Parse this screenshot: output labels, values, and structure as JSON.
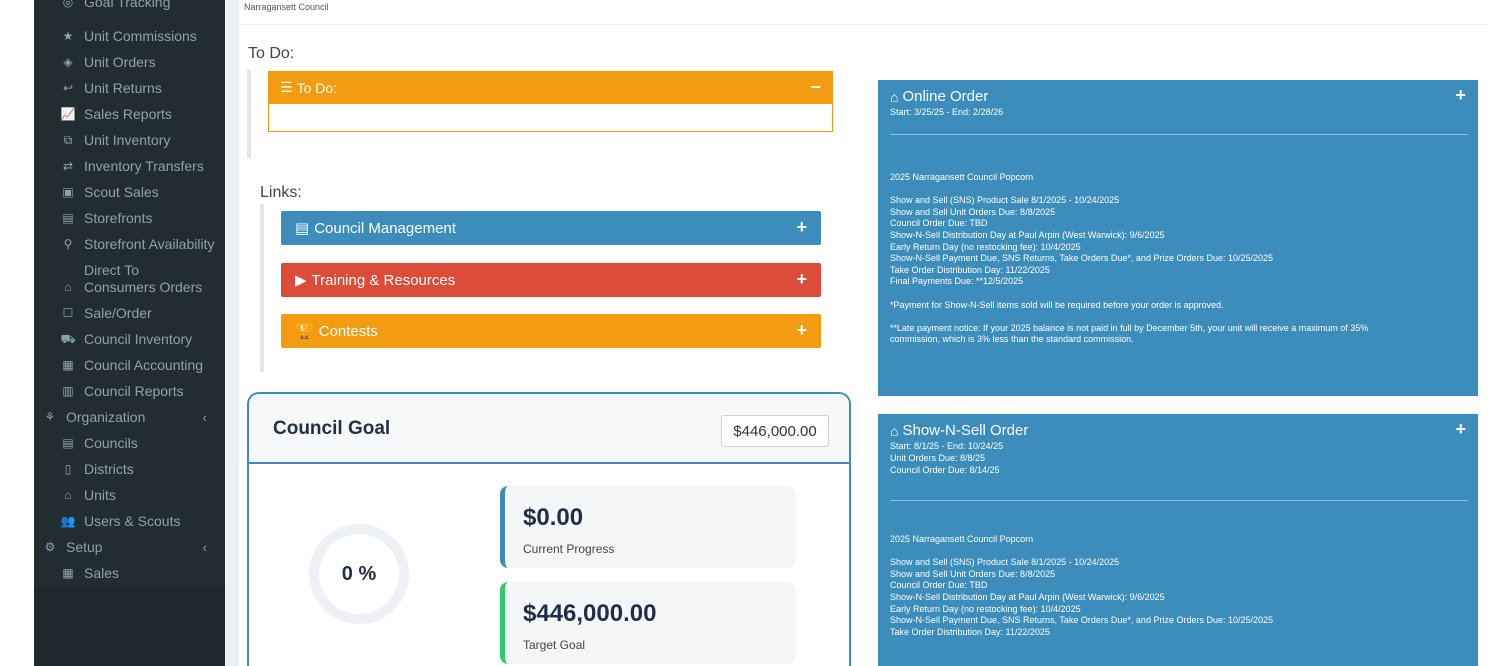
{
  "sidebar": {
    "items": [
      {
        "label": "Goal Tracking",
        "icon": "goal-icon"
      },
      {
        "label": "Unit Commissions",
        "icon": "star-icon"
      },
      {
        "label": "Unit Orders",
        "icon": "tag-icon"
      },
      {
        "label": "Unit Returns",
        "icon": "reply-icon"
      },
      {
        "label": "Sales Reports",
        "icon": "line-chart-icon"
      },
      {
        "label": "Unit Inventory",
        "icon": "cubes-icon"
      },
      {
        "label": "Inventory Transfers",
        "icon": "exchange-icon"
      },
      {
        "label": "Scout Sales",
        "icon": "box-icon"
      },
      {
        "label": "Storefronts",
        "icon": "building-icon"
      },
      {
        "label": "Storefront Availability",
        "icon": "map-marker-icon"
      },
      {
        "label_line1": "Direct To",
        "label_line2": "Consumers Orders",
        "icon": "basket-icon"
      },
      {
        "label": "Sale/Order",
        "icon": "square-icon"
      },
      {
        "label": "Council Inventory",
        "icon": "truck-icon"
      },
      {
        "label": "Council Accounting",
        "icon": "calculator-icon"
      },
      {
        "label": "Council Reports",
        "icon": "bar-chart-icon"
      }
    ],
    "organization": {
      "label": "Organization",
      "icon": "sitemap-icon",
      "chevron": "‹"
    },
    "org_items": [
      {
        "label": "Councils",
        "icon": "building-icon"
      },
      {
        "label": "Districts",
        "icon": "building-outline-icon"
      },
      {
        "label": "Units",
        "icon": "home-icon"
      },
      {
        "label": "Users & Scouts",
        "icon": "users-icon"
      }
    ],
    "setup": {
      "label": "Setup",
      "icon": "cogs-icon",
      "chevron": "‹"
    },
    "setup_items": [
      {
        "label": "Sales",
        "icon": "calendar-icon"
      }
    ]
  },
  "breadcrumb": "Narragansett Council",
  "todo": {
    "section_label": "To Do:",
    "box_title": "To Do:",
    "collapse_symbol": "−"
  },
  "links": {
    "section_label": "Links:",
    "items": [
      {
        "label": "Council Management",
        "icon": "building-icon",
        "symbol": "+"
      },
      {
        "label": "Training & Resources",
        "icon": "youtube-icon",
        "symbol": "+"
      },
      {
        "label": "Contests",
        "icon": "trophy-icon",
        "symbol": "+"
      }
    ]
  },
  "goal": {
    "title": "Council Goal",
    "input_value": "$446,000.00",
    "percent": "0 %",
    "progress_fraction": 0,
    "current_amount": "$0.00",
    "current_label": "Current Progress",
    "target_amount": "$446,000.00",
    "target_label": "Target Goal"
  },
  "online_order": {
    "title": "Online Order",
    "dates": "Start: 3/25/25 - End: 2/28/26",
    "lines": [
      "2025 Narragansett Council Popcorn",
      "",
      "Show and Sell (SNS) Product Sale 8/1/2025 - 10/24/2025",
      "Show and Sell Unit Orders Due: 8/8/2025",
      "Council Order Due: TBD",
      "Show-N-Sell Distribution Day at Paul Arpin (West Warwick): 9/6/2025",
      "Early Return Day (no restocking fee): 10/4/2025",
      "Show-N-Sell Payment Due, SNS Returns, Take Orders Due*, and Prize Orders Due: 10/25/2025",
      "Take Order Distribution Day: 11/22/2025",
      "Final Payments Due: **12/5/2025",
      "",
      "*Payment for Show-N-Sell items sold will be required before your order is approved.",
      "",
      "**Late payment notice: If your 2025 balance is not paid in full by December 5th, your unit will receive a maximum of 35%",
      "commission, which is 3% less than the standard commission."
    ]
  },
  "sns_order": {
    "title": "Show-N-Sell Order",
    "dates": "Start: 8/1/25 - End: 10/24/25",
    "unit_due": "Unit Orders Due: 8/8/25",
    "council_due": "Council Order Due: 8/14/25",
    "lines": [
      "2025 Narragansett Council Popcorn",
      "",
      "Show and Sell (SNS) Product Sale 8/1/2025 - 10/24/2025",
      "Show and Sell Unit Orders Due: 8/8/2025",
      "Council Order Due: TBD",
      "Show-N-Sell Distribution Day at Paul Arpin (West Warwick): 9/6/2025",
      "Early Return Day (no restocking fee): 10/4/2025",
      "Show-N-Sell Payment Due, SNS Returns, Take Orders Due*, and Prize Orders Due: 10/25/2025",
      "Take Order Distribution Day: 11/22/2025"
    ]
  }
}
